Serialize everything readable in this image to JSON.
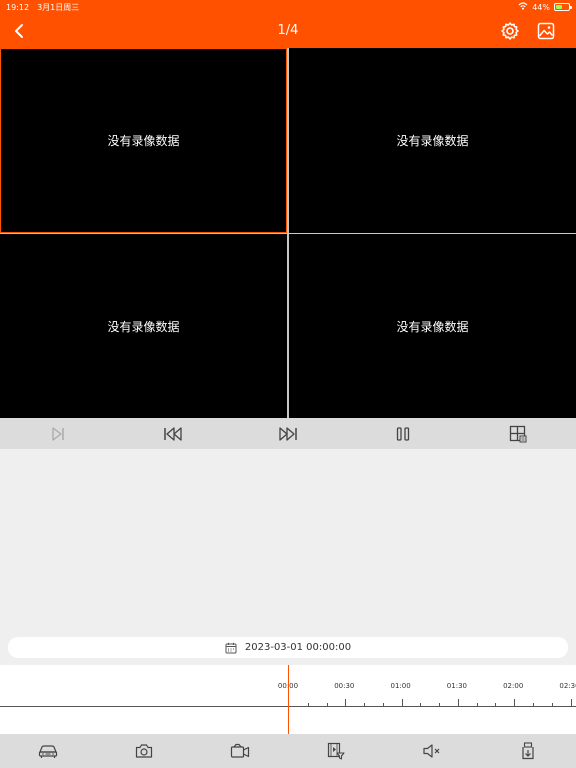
{
  "status_bar": {
    "time": "19:12",
    "date": "3月1日周三",
    "battery": "44%",
    "battery_level": 0.44
  },
  "nav": {
    "title": "1/4"
  },
  "cells": [
    {
      "text": "没有录像数据"
    },
    {
      "text": "没有录像数据"
    },
    {
      "text": "没有录像数据"
    },
    {
      "text": "没有录像数据"
    }
  ],
  "playback_controls": [
    "next-frame-icon",
    "rewind-icon",
    "fast-forward-icon",
    "pause-icon",
    "grid-layout-icon"
  ],
  "date_picker": {
    "value": "2023-03-01 00:00:00"
  },
  "timeline": {
    "labels": [
      "00:00",
      "00:30",
      "01:00",
      "01:30",
      "02:00",
      "02:30"
    ]
  },
  "bottom_toolbar": [
    "car-icon",
    "camera-icon",
    "video-camera-icon",
    "video-filter-icon",
    "mute-icon",
    "download-icon"
  ],
  "colors": {
    "accent": "#ff5100",
    "video_bg": "#000000",
    "panel_bg": "#efefef"
  }
}
